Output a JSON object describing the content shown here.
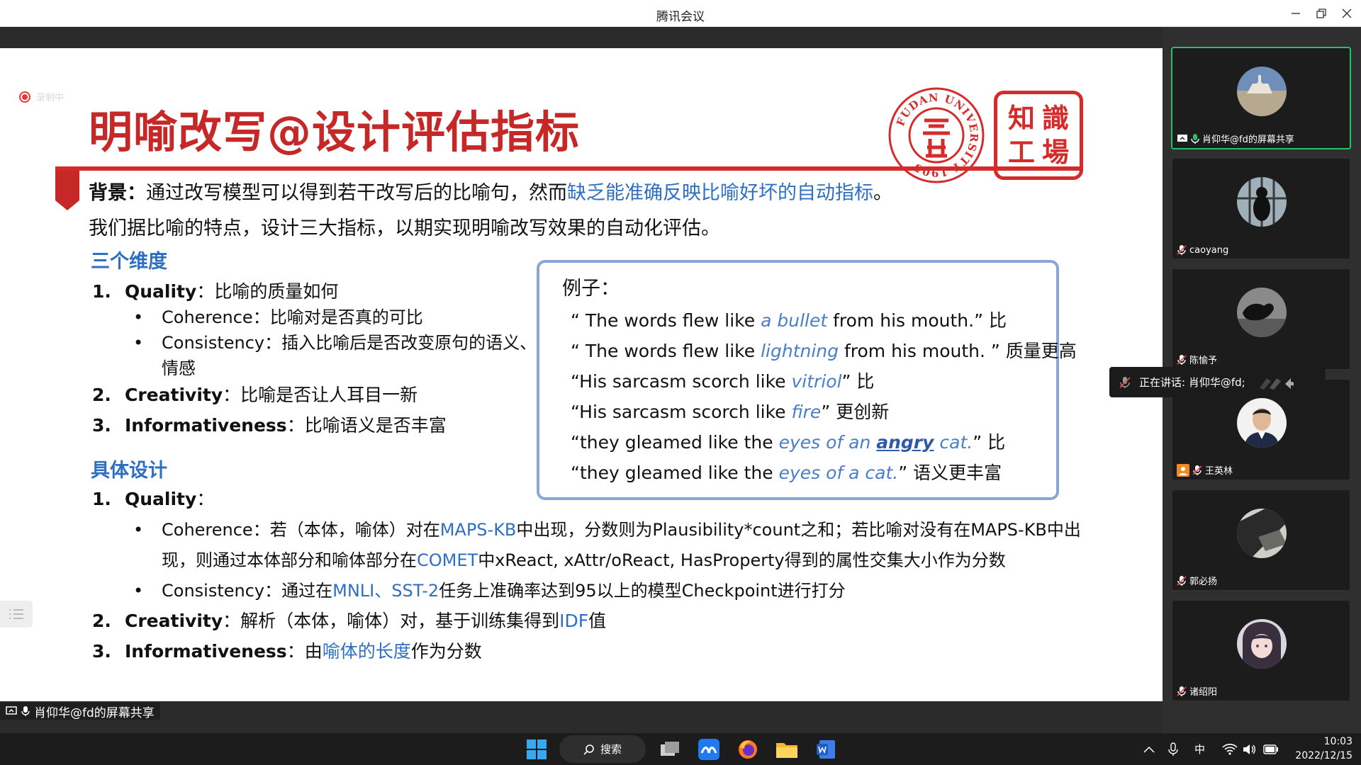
{
  "window": {
    "title": "腾讯会议"
  },
  "recording": {
    "label": "录制中"
  },
  "slide": {
    "title": "明喻改写@设计评估指标",
    "logo_seal_text": "FUDAN UNIVERSITY 1905",
    "logo_box_chars": [
      "知",
      "識",
      "工",
      "場"
    ],
    "background": {
      "label": "背景：",
      "text1": "通过改写模型可以得到若干改写后的比喻句，然而",
      "highlight": "缺乏能准确反映比喻好坏的自动指标",
      "text2": "。",
      "line2": "我们据比喻的特点，设计三大指标，以期实现明喻改写效果的自动化评估。"
    },
    "dimensions": {
      "heading": "三个维度",
      "items": [
        {
          "num": "1.",
          "name": "Quality",
          "desc": "：比喻的质量如何"
        },
        {
          "num": "2.",
          "name": "Creativity",
          "desc": "：比喻是否让人耳目一新"
        },
        {
          "num": "3.",
          "name": "Informativeness",
          "desc": "：比喻语义是否丰富"
        }
      ],
      "bullets": [
        {
          "dot": "•",
          "text": "Coherence：比喻对是否真的可比"
        },
        {
          "dot": "•",
          "text": "Consistency：插入比喻后是否改变原句的语义、"
        }
      ],
      "bullet_cont": "情感"
    },
    "example": {
      "title": "例子：",
      "lines": [
        {
          "pre": "“ The words flew like ",
          "it": "a bullet",
          "post": "  from his mouth.”  比"
        },
        {
          "pre": "“ The words flew like ",
          "it": "lightning",
          "post": " from his mouth. ”  质量更高"
        },
        {
          "pre": "“His sarcasm scorch like ",
          "it": "vitriol",
          "post": "”  比"
        },
        {
          "pre": "“His sarcasm scorch like ",
          "it": "fire",
          "post": "”  更创新"
        },
        {
          "pre": "“they gleamed like the ",
          "it": "eyes of an ",
          "itb": "angry",
          "it2": " cat.",
          "post": "”  比"
        },
        {
          "pre": "“they gleamed like the ",
          "it": "eyes of a cat.",
          "post": "”  语义更丰富"
        }
      ]
    },
    "design": {
      "heading": "具体设计",
      "q_num": "1.",
      "q_name": "Quality",
      "q_colon": "：",
      "coh_pre": "Coherence：若（本体，喻体）对在",
      "coh_kb": "MAPS-KB",
      "coh_mid": "中出现，分数则为Plausibility*count之和；若比喻对没有在MAPS-KB中出",
      "coh2_pre": "现，则通过本体部分和喻体部分在",
      "coh2_comet": "COMET",
      "coh2_post": "中xReact, xAttr/oReact, HasProperty得到的属性交集大小作为分数",
      "con_pre": "Consistency：通过在",
      "con_hl": "MNLI、SST-2",
      "con_post": "任务上准确率达到95以上的模型Checkpoint进行打分",
      "c_num": "2.",
      "c_name": "Creativity",
      "c_pre": "：解析（本体，喻体）对，基于训练集得到",
      "c_hl": "IDF",
      "c_post": "值",
      "i_num": "3.",
      "i_name": "Informativeness",
      "i_pre": "：由",
      "i_hl": "喻体的长度",
      "i_post": "作为分数"
    }
  },
  "share_label": "肖仰华@fd的屏幕共享",
  "participants": [
    {
      "name": "肖仰华@fd的屏幕共享",
      "active": true
    },
    {
      "name": "caoyang",
      "active": false
    },
    {
      "name": "陈愉予",
      "active": false
    },
    {
      "name": "王英林",
      "active": false
    },
    {
      "name": "郭必扬",
      "active": false
    },
    {
      "name": "诸绍阳",
      "active": false
    }
  ],
  "speaking": {
    "text": "正在讲话: 肖仰华@fd;"
  },
  "taskbar": {
    "search_label": "搜索",
    "ime": "中",
    "time": "10:03",
    "date": "2022/12/15",
    "icons": [
      "windows-start-icon",
      "search-icon",
      "task-view-icon",
      "meeting-app-icon",
      "firefox-icon",
      "file-explorer-icon",
      "word-icon"
    ]
  },
  "colors": {
    "accent_red": "#d62b2b",
    "title_red": "#c62828",
    "link_blue": "#2e6fc2",
    "active_green": "#24c06a"
  }
}
